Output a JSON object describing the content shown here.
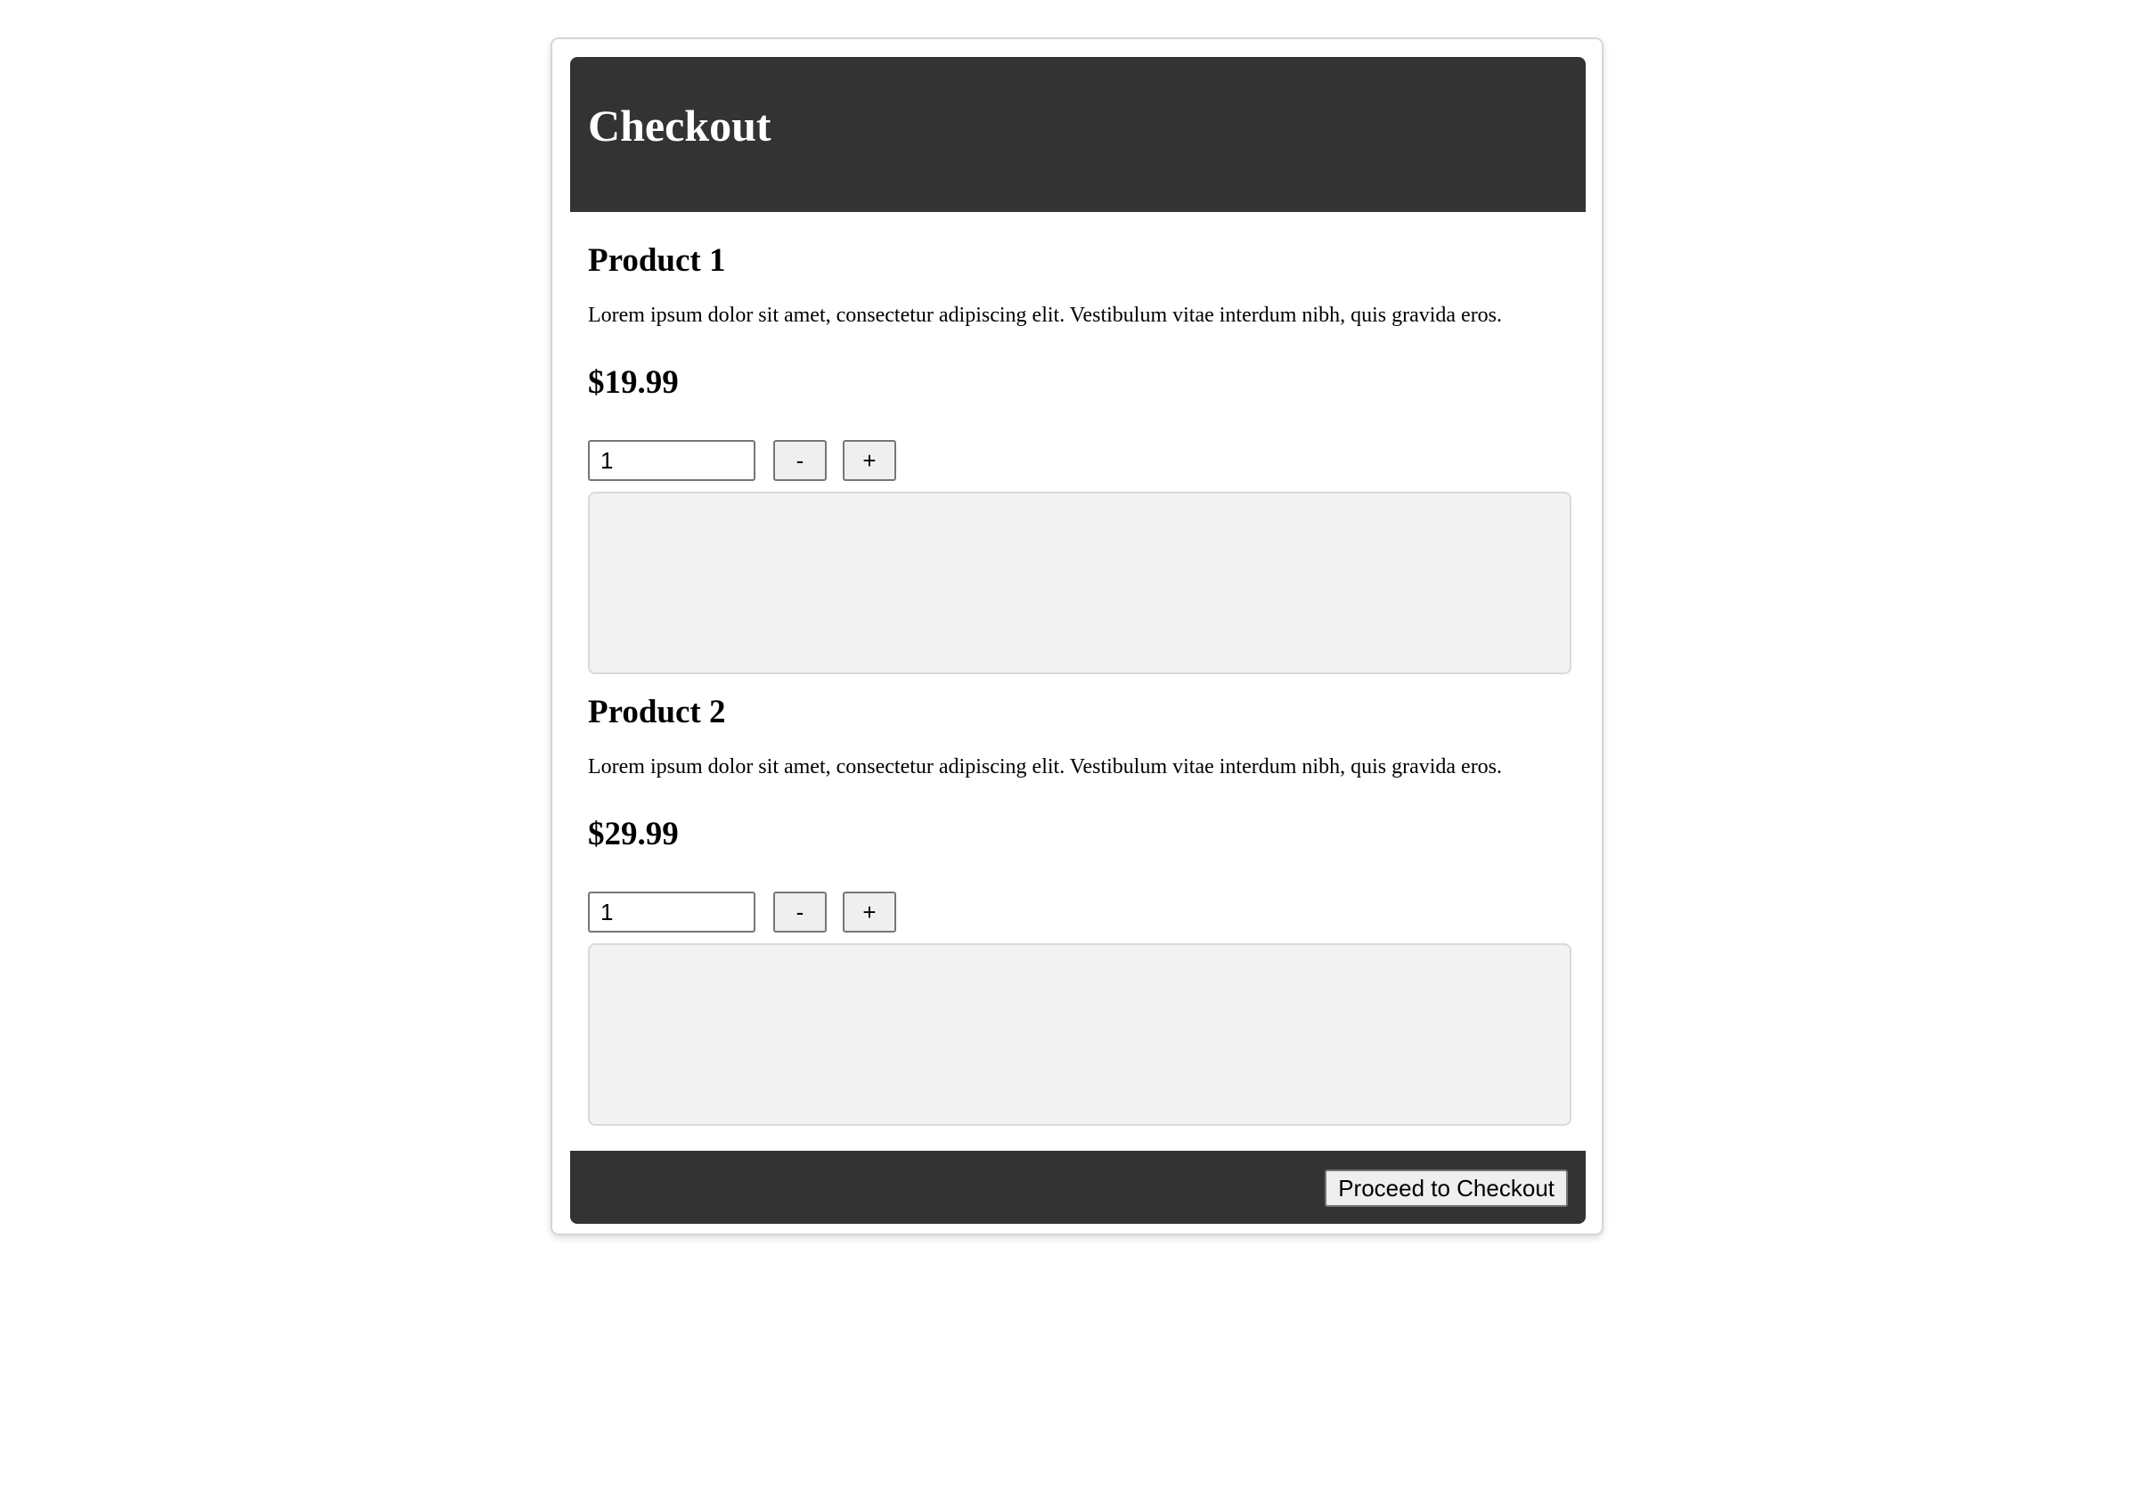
{
  "header": {
    "title": "Checkout"
  },
  "products": [
    {
      "name": "Product 1",
      "description": "Lorem ipsum dolor sit amet, consectetur adipiscing elit. Vestibulum vitae interdum nibh, quis gravida eros.",
      "price": "$19.99",
      "quantity": "1",
      "decrement_label": "-",
      "increment_label": "+"
    },
    {
      "name": "Product 2",
      "description": "Lorem ipsum dolor sit amet, consectetur adipiscing elit. Vestibulum vitae interdum nibh, quis gravida eros.",
      "price": "$29.99",
      "quantity": "1",
      "decrement_label": "-",
      "increment_label": "+"
    }
  ],
  "footer": {
    "checkout_label": "Proceed to Checkout"
  },
  "colors": {
    "header_bg": "#333333",
    "footer_bg": "#333333",
    "image_placeholder_bg": "#f2f2f2",
    "button_bg": "#efefef"
  }
}
